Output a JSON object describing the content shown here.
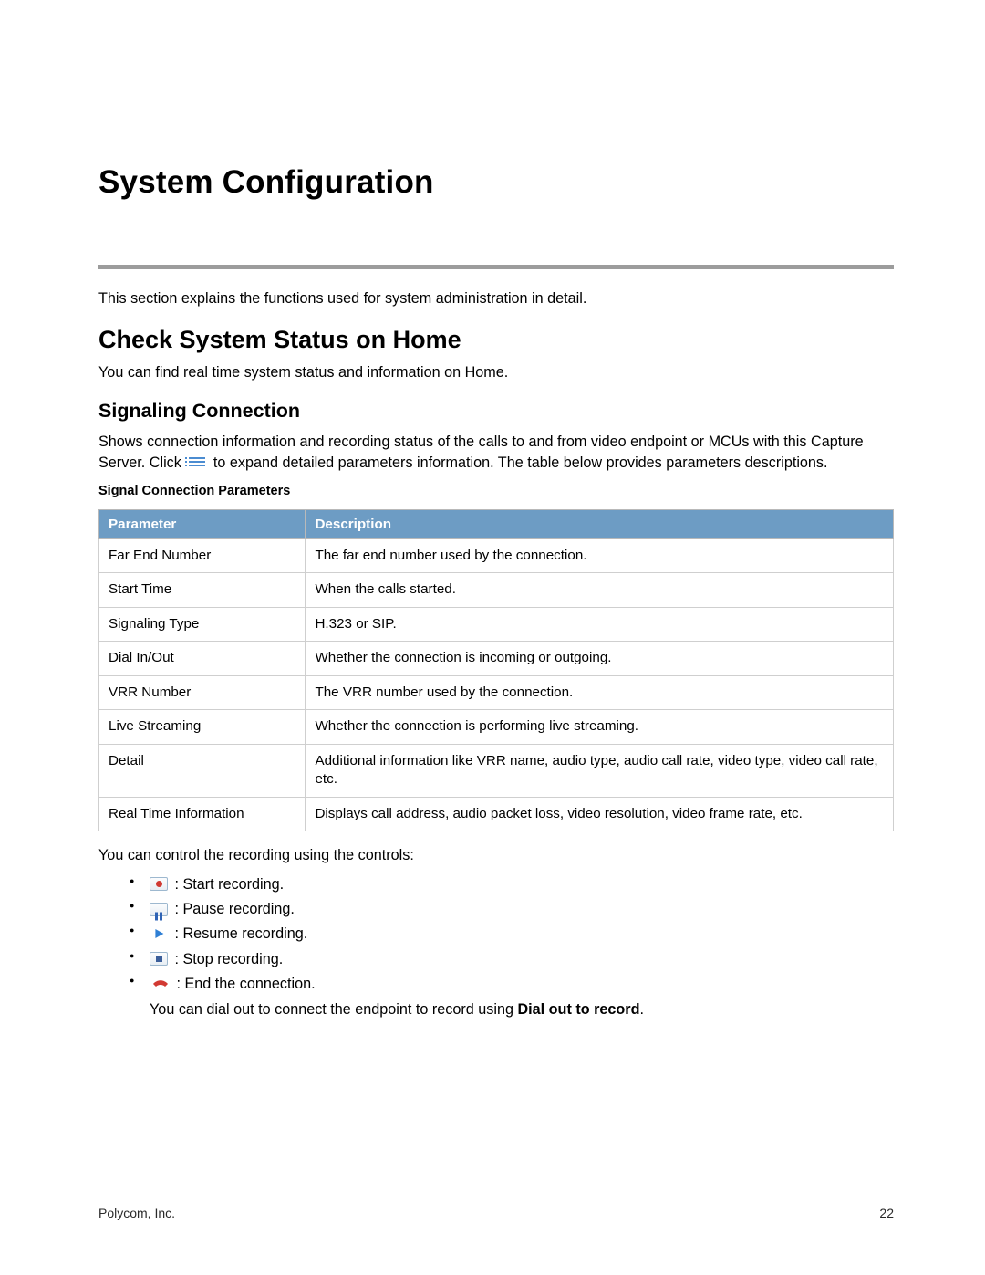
{
  "title": "System Configuration",
  "intro": "This section explains the functions used for system administration in detail.",
  "section": {
    "heading": "Check System Status on Home",
    "text": "You can find real time system status and information on Home."
  },
  "subsection": {
    "heading": "Signaling Connection",
    "text_before_icon": "Shows connection information and recording status of the calls to and from video endpoint or MCUs with this Capture Server. Click ",
    "text_after_icon": " to expand detailed parameters information. The table below provides parameters descriptions."
  },
  "table": {
    "caption": "Signal Connection Parameters",
    "headers": {
      "param": "Parameter",
      "desc": "Description"
    },
    "rows": [
      {
        "param": "Far End Number",
        "desc": "The far end number used by the connection."
      },
      {
        "param": "Start Time",
        "desc": "When the calls started."
      },
      {
        "param": "Signaling Type",
        "desc": "H.323 or SIP."
      },
      {
        "param": "Dial In/Out",
        "desc": "Whether the connection is incoming or outgoing."
      },
      {
        "param": "VRR Number",
        "desc": "The VRR number used by the connection."
      },
      {
        "param": "Live Streaming",
        "desc": "Whether the connection is performing live streaming."
      },
      {
        "param": "Detail",
        "desc": "Additional information like VRR name, audio type, audio call rate, video type, video call rate, etc."
      },
      {
        "param": "Real Time Information",
        "desc": "Displays call address, audio packet loss, video resolution, video frame rate, etc."
      }
    ]
  },
  "controls": {
    "intro": "You can control the recording using the controls:",
    "items": [
      ": Start recording.",
      ": Pause recording.",
      ": Resume recording.",
      ": Stop recording.",
      ": End the connection."
    ],
    "dialout_prefix": "You can dial out to connect the endpoint to record using ",
    "dialout_bold": "Dial out to record",
    "dialout_suffix": "."
  },
  "footer": {
    "company": "Polycom, Inc.",
    "page": "22"
  }
}
